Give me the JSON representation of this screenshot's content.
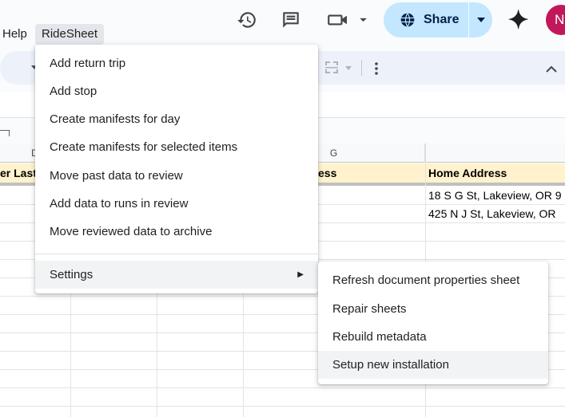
{
  "menubar": {
    "help": "Help",
    "ridesheet": "RideSheet"
  },
  "header": {
    "share_label": "Share",
    "avatar_initial": "N",
    "icons": [
      "history-icon",
      "comment-icon",
      "video-call-icon",
      "globe-icon",
      "gemini-sparkle-icon"
    ]
  },
  "sheet": {
    "columns": [
      "D",
      "G"
    ],
    "header_cells": {
      "left": "er Last",
      "middle": "ess",
      "right": "Home Address"
    },
    "rows": [
      "18 S G St, Lakeview, OR 9",
      "425 N J St, Lakeview, OR"
    ]
  },
  "ridesheet_menu": {
    "items": [
      "Add return trip",
      "Add stop",
      "Create manifests for day",
      "Create manifests for selected items",
      "Move past data to review",
      "Add data to runs in review",
      "Move reviewed data to archive"
    ],
    "settings": "Settings"
  },
  "settings_submenu": {
    "items": [
      "Refresh document properties sheet",
      "Repair sheets",
      "Rebuild metadata",
      "Setup new installation"
    ]
  },
  "colors": {
    "share_bg": "#c2e7ff",
    "header_band": "#fff2cc",
    "avatar": "#c2185b",
    "toolbar_bg": "#edf2fa"
  }
}
